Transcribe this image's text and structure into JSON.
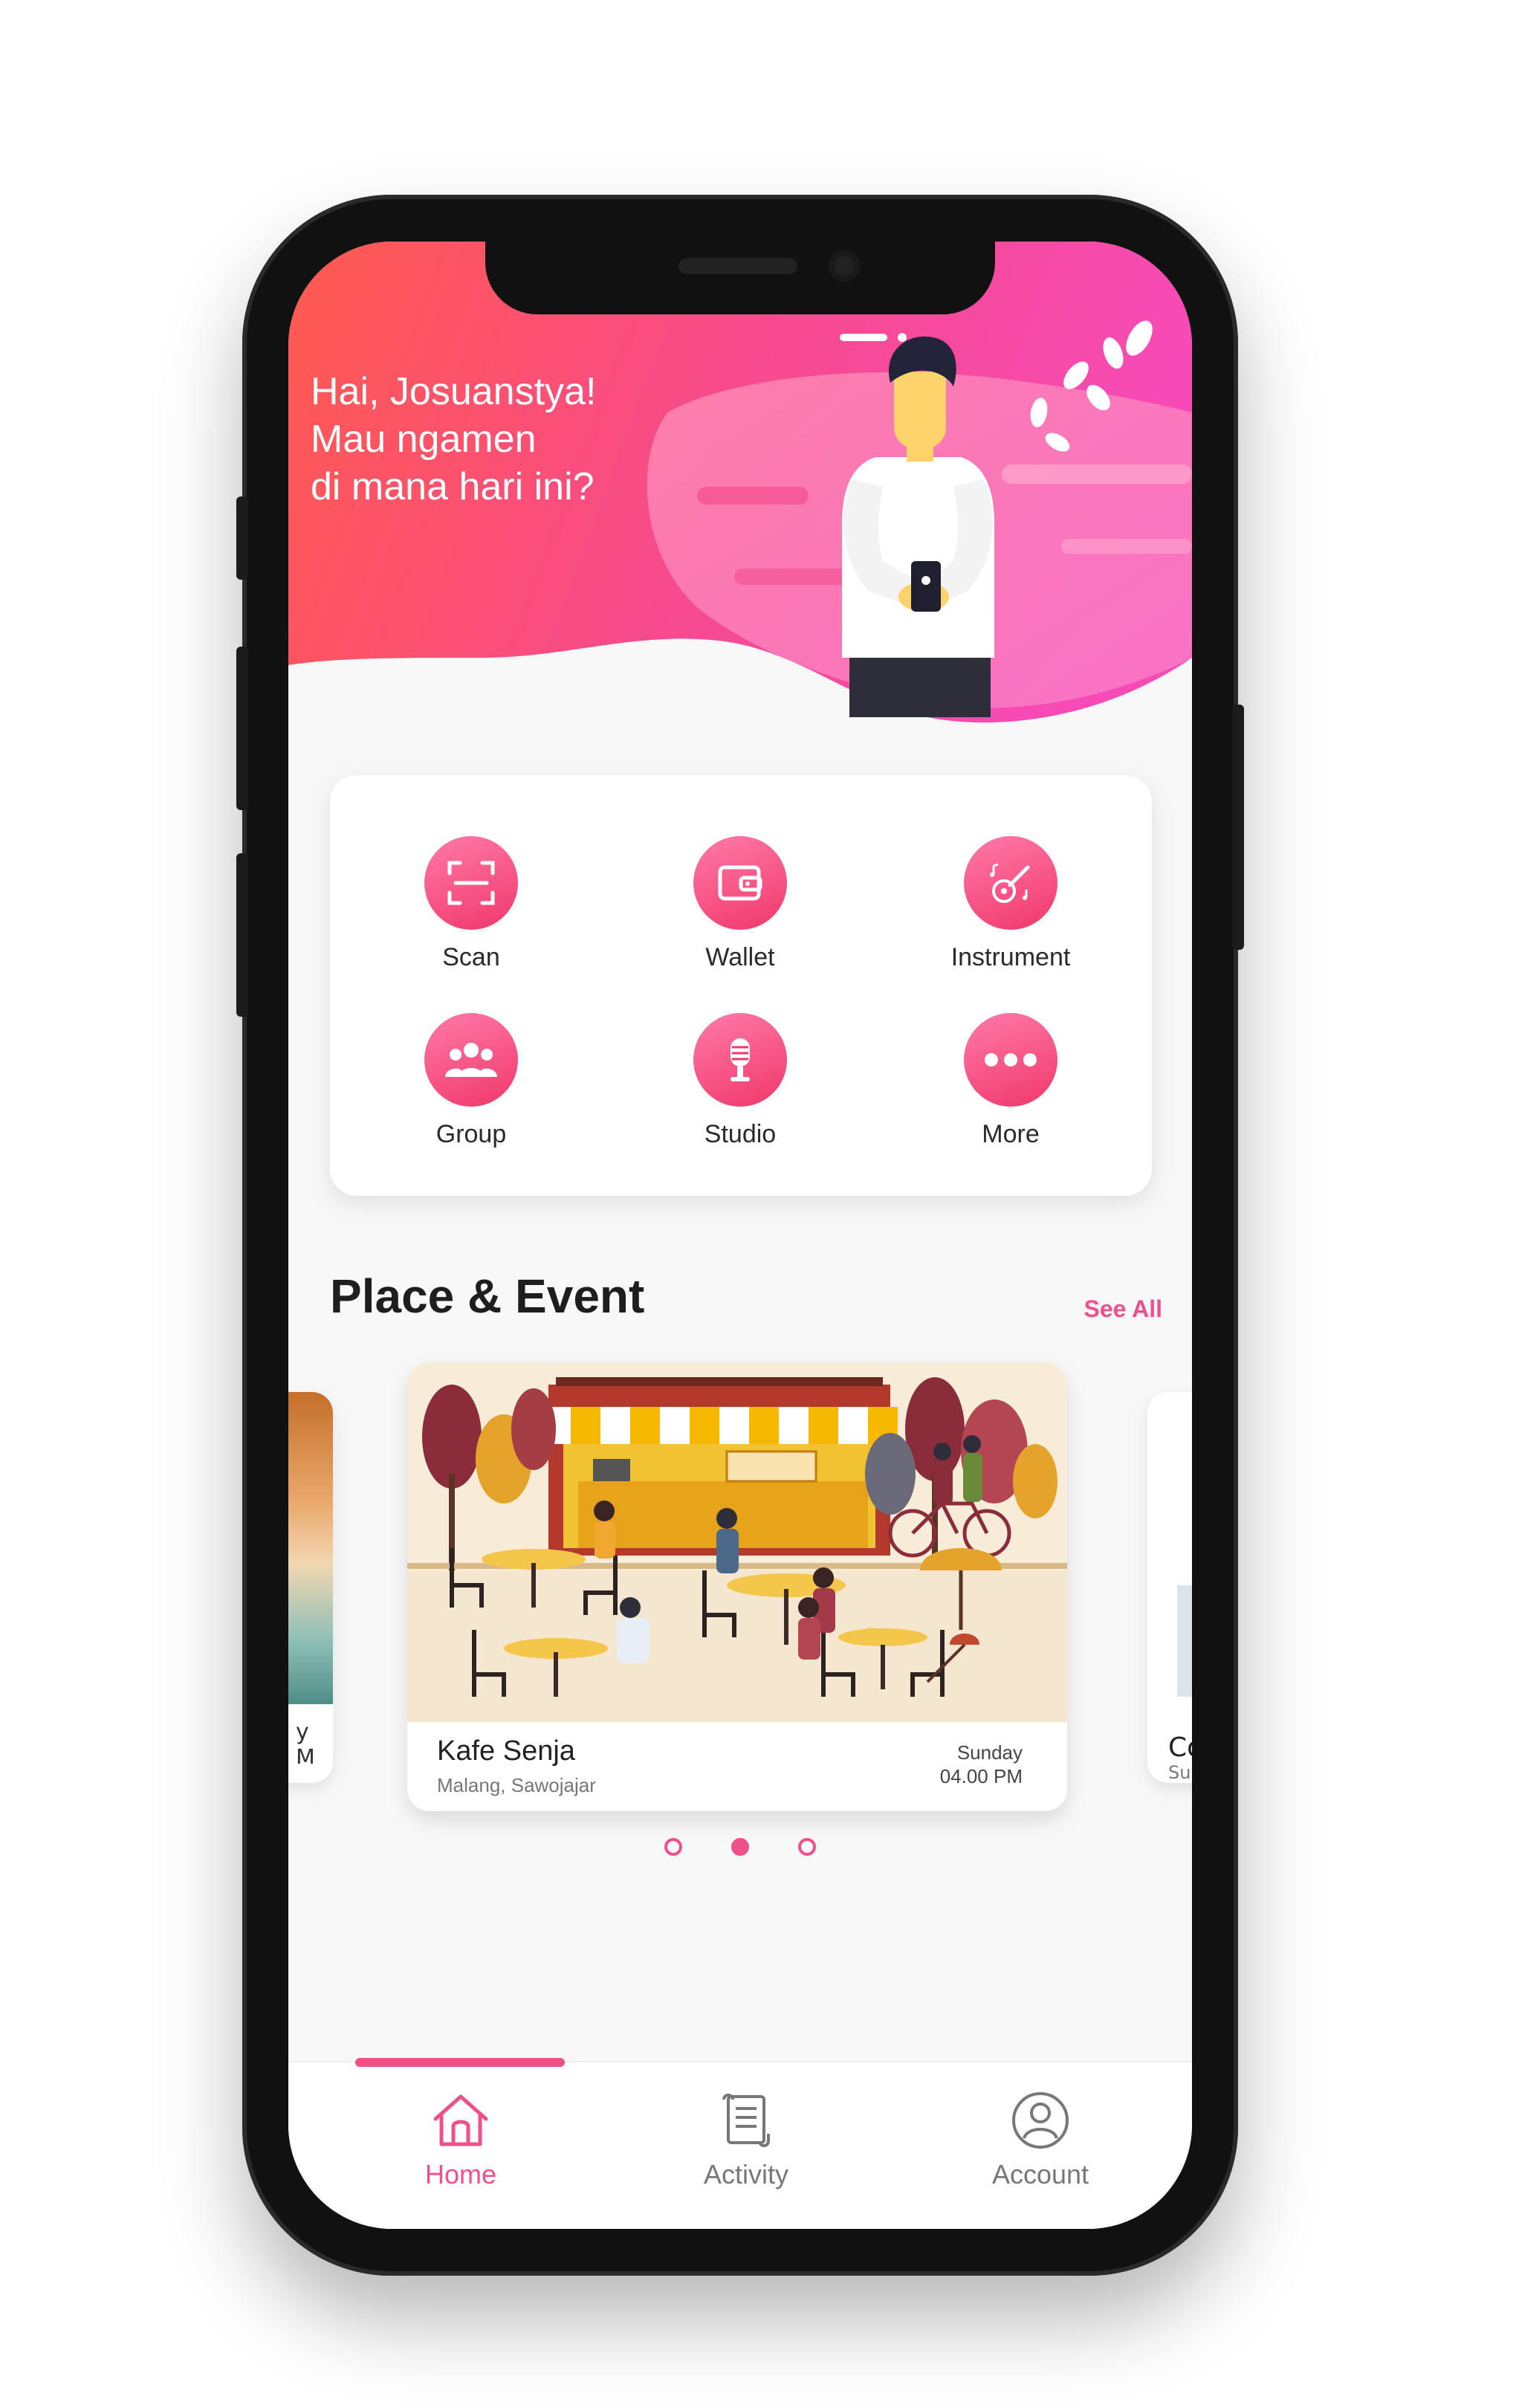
{
  "header": {
    "greeting_lines": [
      "Hai, Josuanstya!",
      "Mau ngamen",
      "di mana hari ini?"
    ]
  },
  "menu": {
    "items": [
      {
        "label": "Scan",
        "icon": "scan-icon"
      },
      {
        "label": "Wallet",
        "icon": "wallet-icon"
      },
      {
        "label": "Instrument",
        "icon": "guitar-icon"
      },
      {
        "label": "Group",
        "icon": "group-icon"
      },
      {
        "label": "Studio",
        "icon": "microphone-icon"
      },
      {
        "label": "More",
        "icon": "more-icon"
      }
    ]
  },
  "section": {
    "title": "Place & Event",
    "see_all": "See All"
  },
  "carousel": {
    "cards": [
      {
        "name": "Kafe Senja",
        "location": "Malang, Sawojajar",
        "day": "Sunday",
        "time": "04.00 PM"
      }
    ],
    "left_peek_text": "y\nM",
    "right_peek_title": "Co",
    "right_peek_sub": "Su",
    "dots": 3,
    "active_dot": 1
  },
  "bottom_nav": {
    "items": [
      {
        "label": "Home",
        "icon": "home-icon",
        "active": true
      },
      {
        "label": "Activity",
        "icon": "scroll-icon",
        "active": false
      },
      {
        "label": "Account",
        "icon": "user-icon",
        "active": false
      }
    ]
  },
  "colors": {
    "accent": "#f0508a",
    "header_start": "#ff5a4e",
    "header_end": "#f64bb6"
  }
}
